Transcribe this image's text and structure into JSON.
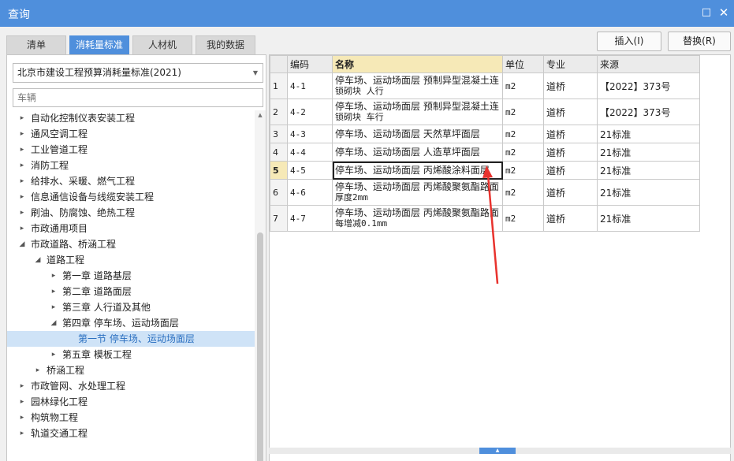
{
  "window": {
    "title": "查询",
    "maximize_glyph": "□",
    "close_glyph": "✕"
  },
  "tabs": [
    {
      "label": "清单",
      "active": false
    },
    {
      "label": "消耗量标准",
      "active": true
    },
    {
      "label": "人材机",
      "active": false
    },
    {
      "label": "我的数据",
      "active": false
    }
  ],
  "actions": {
    "insert_label": "插入(I)",
    "replace_label": "替换(R)"
  },
  "left": {
    "standard_select": "北京市建设工程预算消耗量标准(2021)",
    "search_placeholder": "车辆",
    "tree": [
      {
        "label": "自动化控制仪表安装工程",
        "level": 0,
        "state": "collapsed"
      },
      {
        "label": "通风空调工程",
        "level": 0,
        "state": "collapsed"
      },
      {
        "label": "工业管道工程",
        "level": 0,
        "state": "collapsed"
      },
      {
        "label": "消防工程",
        "level": 0,
        "state": "collapsed"
      },
      {
        "label": "给排水、采暖、燃气工程",
        "level": 0,
        "state": "collapsed"
      },
      {
        "label": "信息通信设备与线缆安装工程",
        "level": 0,
        "state": "collapsed"
      },
      {
        "label": "刷油、防腐蚀、绝热工程",
        "level": 0,
        "state": "collapsed"
      },
      {
        "label": "市政通用项目",
        "level": 0,
        "state": "collapsed"
      },
      {
        "label": "市政道路、桥涵工程",
        "level": 0,
        "state": "expanded"
      },
      {
        "label": "道路工程",
        "level": 1,
        "state": "expanded"
      },
      {
        "label": "第一章 道路基层",
        "level": 2,
        "state": "collapsed"
      },
      {
        "label": "第二章 道路面层",
        "level": 2,
        "state": "collapsed"
      },
      {
        "label": "第三章 人行道及其他",
        "level": 2,
        "state": "collapsed"
      },
      {
        "label": "第四章 停车场、运动场面层",
        "level": 2,
        "state": "expanded"
      },
      {
        "label": "第一节 停车场、运动场面层",
        "level": 3,
        "state": "leaf",
        "selected": true
      },
      {
        "label": "第五章 模板工程",
        "level": 2,
        "state": "collapsed"
      },
      {
        "label": "桥涵工程",
        "level": 1,
        "state": "collapsed"
      },
      {
        "label": "市政管网、水处理工程",
        "level": 0,
        "state": "collapsed"
      },
      {
        "label": "园林绿化工程",
        "level": 0,
        "state": "collapsed"
      },
      {
        "label": "构筑物工程",
        "level": 0,
        "state": "collapsed"
      },
      {
        "label": "轨道交通工程",
        "level": 0,
        "state": "collapsed"
      }
    ]
  },
  "grid": {
    "columns": [
      "",
      "编码",
      "名称",
      "单位",
      "专业",
      "来源"
    ],
    "current_row": 5,
    "rows": [
      {
        "no": "1",
        "code": "4-1",
        "name": "停车场、运动场面层 预制异型混凝土连锁砌块 人行",
        "name_lines": [
          "停车场、运动场面层 预制异型混凝土连",
          "锁砌块 人行"
        ],
        "unit": "m2",
        "major": "道桥",
        "source": "【2022】373号"
      },
      {
        "no": "2",
        "code": "4-2",
        "name": "停车场、运动场面层 预制异型混凝土连锁砌块 车行",
        "name_lines": [
          "停车场、运动场面层 预制异型混凝土连",
          "锁砌块 车行"
        ],
        "unit": "m2",
        "major": "道桥",
        "source": "【2022】373号"
      },
      {
        "no": "3",
        "code": "4-3",
        "name": "停车场、运动场面层 天然草坪面层",
        "name_lines": [
          "停车场、运动场面层 天然草坪面层"
        ],
        "unit": "m2",
        "major": "道桥",
        "source": "21标准"
      },
      {
        "no": "4",
        "code": "4-4",
        "name": "停车场、运动场面层 人造草坪面层",
        "name_lines": [
          "停车场、运动场面层 人造草坪面层"
        ],
        "unit": "m2",
        "major": "道桥",
        "source": "21标准"
      },
      {
        "no": "5",
        "code": "4-5",
        "name": "停车场、运动场面层 丙烯酸涂料面层",
        "name_lines": [
          "停车场、运动场面层 丙烯酸涂料面层"
        ],
        "unit": "m2",
        "major": "道桥",
        "source": "21标准"
      },
      {
        "no": "6",
        "code": "4-6",
        "name": "停车场、运动场面层 丙烯酸聚氨酯路面 厚度2mm",
        "name_lines": [
          "停车场、运动场面层 丙烯酸聚氨酯路面",
          "厚度2mm"
        ],
        "unit": "m2",
        "major": "道桥",
        "source": "21标准"
      },
      {
        "no": "7",
        "code": "4-7",
        "name": "停车场、运动场面层 丙烯酸聚氨酯路面 每增减0.1mm",
        "name_lines": [
          "停车场、运动场面层 丙烯酸聚氨酯路面",
          "每增减0.1mm"
        ],
        "unit": "m2",
        "major": "道桥",
        "source": "21标准"
      }
    ]
  },
  "annotation_color": "#e8322d"
}
